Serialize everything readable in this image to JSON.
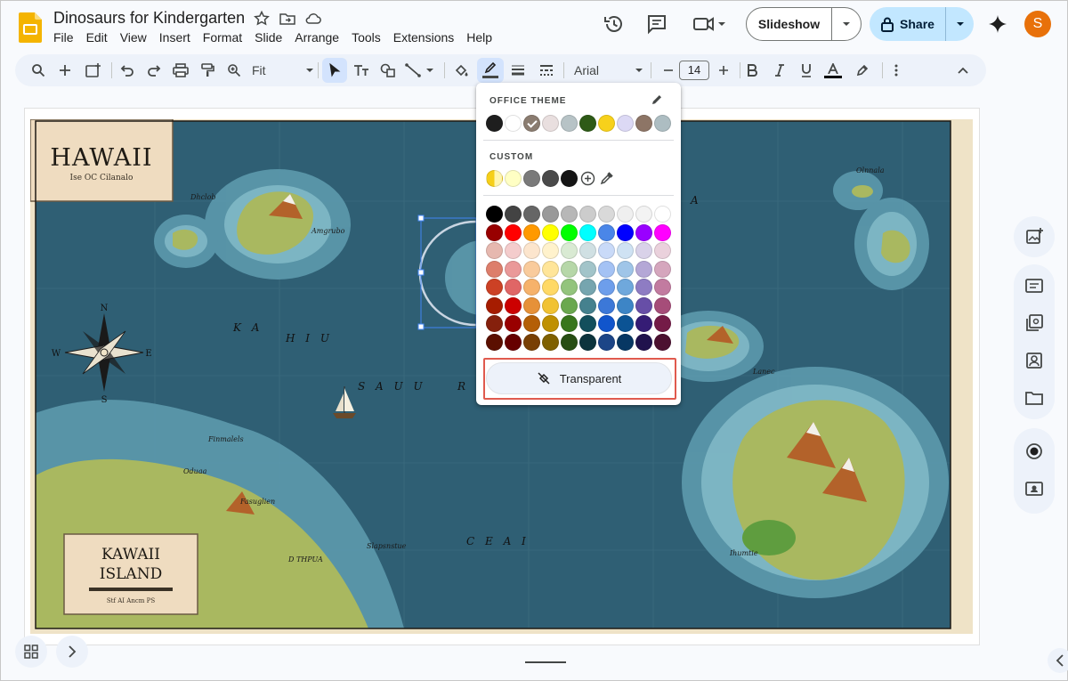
{
  "app": {
    "doc_title": "Dinosaurs for Kindergarten",
    "menu": [
      "File",
      "Edit",
      "View",
      "Insert",
      "Format",
      "Slide",
      "Arrange",
      "Tools",
      "Extensions",
      "Help"
    ],
    "slideshow_label": "Slideshow",
    "share_label": "Share",
    "avatar_initial": "S",
    "avatar_color": "#e8710a"
  },
  "toolbar": {
    "zoom_label": "Fit",
    "font_label": "Arial",
    "font_size": "14"
  },
  "slide": {
    "map_title": "HAWAII",
    "map_subtitle": "Ise OC Cilanalo",
    "inset_title_line1": "KAWAII",
    "inset_title_line2": "ISLAND",
    "inset_caption": "Stf AI Ancm PS",
    "compass_labels": [
      "N",
      "W",
      "E",
      "S"
    ],
    "sea_labels": [
      "K A",
      "H I U",
      "S A U U",
      "R",
      "C E A I",
      "A",
      "A I"
    ],
    "place_labels": [
      "Dhclob",
      "Amgrubo",
      "Finmalels",
      "Oduaa",
      "Fasuglien",
      "D THPUA",
      "Slapsnstue",
      "Olnnala",
      "Lanec",
      "Ihumtie"
    ],
    "colors": {
      "ocean": "#2f5f74",
      "shallow": "#5f9db0",
      "land": "#a9b860",
      "frame": "#efe3c7"
    }
  },
  "color_popup": {
    "office_theme_heading": "OFFICE THEME",
    "custom_heading": "CUSTOM",
    "transparent_label": "Transparent",
    "theme_colors": [
      "#1e1e1e",
      "#ffffff",
      "#8a7c70",
      "#e9dfdf",
      "#b7c3c6",
      "#2e5a17",
      "#f7d11b",
      "#dcd9f5",
      "#8d7566",
      "#adbdc2"
    ],
    "custom_colors": [
      "#f6cf1a",
      "#ffffc4",
      "#7a7a7a",
      "#4a4a4a",
      "#151515"
    ],
    "palette": [
      [
        "#000000",
        "#434343",
        "#666666",
        "#999999",
        "#b7b7b7",
        "#cccccc",
        "#d9d9d9",
        "#efefef",
        "#f3f3f3",
        "#ffffff"
      ],
      [
        "#980000",
        "#ff0000",
        "#ff9900",
        "#ffff00",
        "#00ff00",
        "#00ffff",
        "#4a86e8",
        "#0000ff",
        "#9900ff",
        "#ff00ff"
      ],
      [
        "#e6b8af",
        "#f4cccc",
        "#fce5cd",
        "#fff2cc",
        "#d9ead3",
        "#d0e0e3",
        "#c9daf8",
        "#cfe2f3",
        "#d9d2e9",
        "#ead1dc"
      ],
      [
        "#dd7e6b",
        "#ea9999",
        "#f9cb9c",
        "#ffe599",
        "#b6d7a8",
        "#a2c4c9",
        "#a4c2f4",
        "#9fc5e8",
        "#b4a7d6",
        "#d5a6bd"
      ],
      [
        "#cc4125",
        "#e06666",
        "#f6b26b",
        "#ffd966",
        "#93c47d",
        "#76a5af",
        "#6d9eeb",
        "#6fa8dc",
        "#8e7cc3",
        "#c27ba0"
      ],
      [
        "#a61c00",
        "#cc0000",
        "#e69138",
        "#f1c232",
        "#6aa84f",
        "#45818e",
        "#3c78d8",
        "#3d85c6",
        "#674ea7",
        "#a64d79"
      ],
      [
        "#85200c",
        "#990000",
        "#b45f06",
        "#bf9000",
        "#38761d",
        "#134f5c",
        "#1155cc",
        "#0b5394",
        "#351c75",
        "#741b47"
      ],
      [
        "#5b0f00",
        "#660000",
        "#783f04",
        "#7f6000",
        "#274e13",
        "#0c343d",
        "#1c4587",
        "#073763",
        "#20124d",
        "#4c1130"
      ]
    ]
  }
}
